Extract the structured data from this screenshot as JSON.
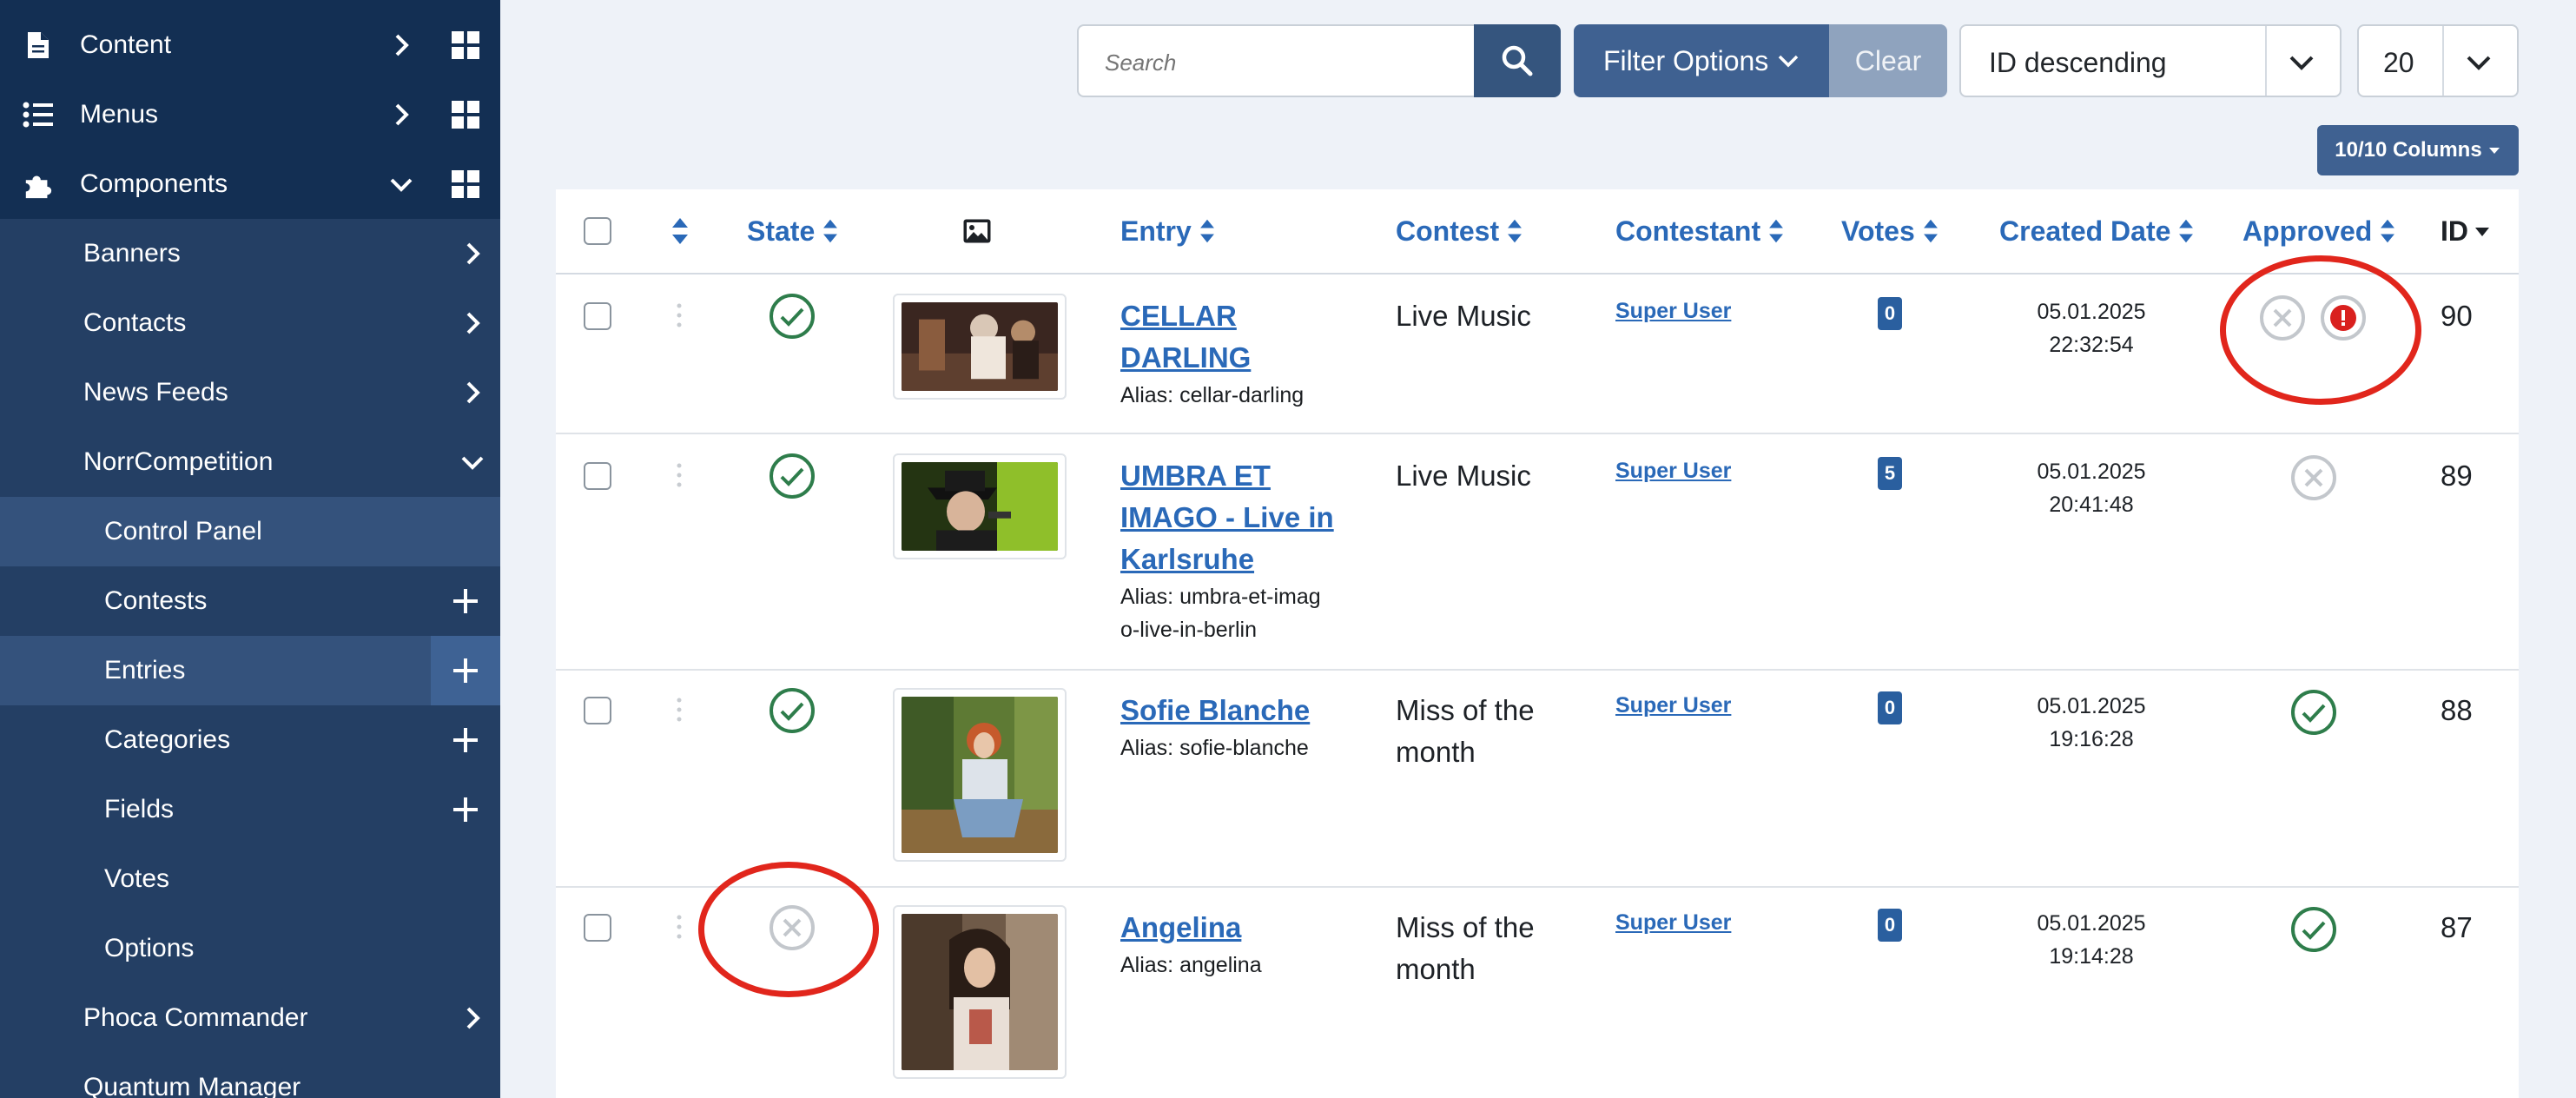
{
  "sidebar": {
    "items": [
      {
        "label": "Content",
        "icon": "file-icon"
      },
      {
        "label": "Menus",
        "icon": "list-icon"
      },
      {
        "label": "Components",
        "icon": "puzzle-icon"
      },
      {
        "label": "Banners"
      },
      {
        "label": "Contacts"
      },
      {
        "label": "News Feeds"
      },
      {
        "label": "NorrCompetition"
      },
      {
        "label": "Control Panel"
      },
      {
        "label": "Contests"
      },
      {
        "label": "Entries"
      },
      {
        "label": "Categories"
      },
      {
        "label": "Fields"
      },
      {
        "label": "Votes"
      },
      {
        "label": "Options"
      },
      {
        "label": "Phoca Commander"
      },
      {
        "label": "Quantum Manager"
      }
    ]
  },
  "toolbar": {
    "search_placeholder": "Search",
    "filter_label": "Filter Options",
    "clear_label": "Clear",
    "sort_value": "ID descending",
    "limit_value": "20",
    "columns_label": "10/10 Columns"
  },
  "table": {
    "headers": {
      "state": "State",
      "entry": "Entry",
      "contest": "Contest",
      "contestant": "Contestant",
      "votes": "Votes",
      "created": "Created Date",
      "approved": "Approved",
      "id": "ID"
    },
    "rows": [
      {
        "title_lines": [
          "CELLAR",
          "DARLING"
        ],
        "alias_lines": [
          "Alias: cellar-darling"
        ],
        "contest_lines": [
          "Live Music"
        ],
        "contestant": "Super User",
        "votes": "0",
        "date": "05.01.2025",
        "time": "22:32:54",
        "id": "90",
        "state": "published",
        "approved": "pending-warning"
      },
      {
        "title_lines": [
          "UMBRA ET",
          "IMAGO - Live in",
          "Karlsruhe"
        ],
        "alias_lines": [
          "Alias: umbra-et-imag",
          "o-live-in-berlin"
        ],
        "contest_lines": [
          "Live Music"
        ],
        "contestant": "Super User",
        "votes": "5",
        "date": "05.01.2025",
        "time": "20:41:48",
        "id": "89",
        "state": "published",
        "approved": "unapproved"
      },
      {
        "title_lines": [
          "Sofie Blanche"
        ],
        "alias_lines": [
          "Alias: sofie-blanche"
        ],
        "contest_lines": [
          "Miss of the",
          "month"
        ],
        "contestant": "Super User",
        "votes": "0",
        "date": "05.01.2025",
        "time": "19:16:28",
        "id": "88",
        "state": "published",
        "approved": "approved"
      },
      {
        "title_lines": [
          "Angelina"
        ],
        "alias_lines": [
          "Alias: angelina"
        ],
        "contest_lines": [
          "Miss of the",
          "month"
        ],
        "contestant": "Super User",
        "votes": "0",
        "date": "05.01.2025",
        "time": "19:14:28",
        "id": "87",
        "state": "unpublished",
        "approved": "approved"
      }
    ]
  },
  "colors": {
    "sidebar_bg": "#132f53",
    "sidebar_sub": "#243f64",
    "sidebar_active": "#34527c",
    "link": "#2a69b8",
    "success": "#2e7d4b",
    "muted": "#c3c7cc",
    "danger": "#d9201e",
    "highlight": "#e1261c"
  }
}
